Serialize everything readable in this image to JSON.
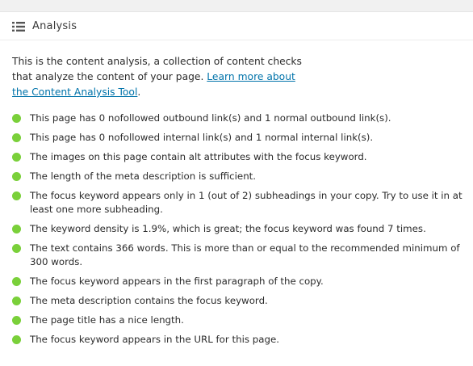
{
  "header": {
    "title": "Analysis",
    "icon": "list-icon"
  },
  "intro": {
    "text": "This is the content analysis, a collection of content checks that analyze the content of your page. ",
    "link_label": "Learn more about the Content Analysis Tool",
    "link_suffix": "."
  },
  "status_color": "#7ad03a",
  "results": [
    {
      "status": "good",
      "text": "This page has 0 nofollowed outbound link(s) and 1 normal outbound link(s)."
    },
    {
      "status": "good",
      "text": "This page has 0 nofollowed internal link(s) and 1 normal internal link(s)."
    },
    {
      "status": "good",
      "text": "The images on this page contain alt attributes with the focus keyword."
    },
    {
      "status": "good",
      "text": "The length of the meta description is sufficient."
    },
    {
      "status": "good",
      "text": "The focus keyword appears only in 1 (out of 2) subheadings in your copy. Try to use it in at least one more subheading."
    },
    {
      "status": "good",
      "text": "The keyword density is 1.9%, which is great; the focus keyword was found 7 times."
    },
    {
      "status": "good",
      "text": "The text contains 366 words. This is more than or equal to the recommended minimum of 300 words."
    },
    {
      "status": "good",
      "text": "The focus keyword appears in the first paragraph of the copy."
    },
    {
      "status": "good",
      "text": "The meta description contains the focus keyword."
    },
    {
      "status": "good",
      "text": "The page title has a nice length."
    },
    {
      "status": "good",
      "text": "The focus keyword appears in the URL for this page."
    }
  ]
}
